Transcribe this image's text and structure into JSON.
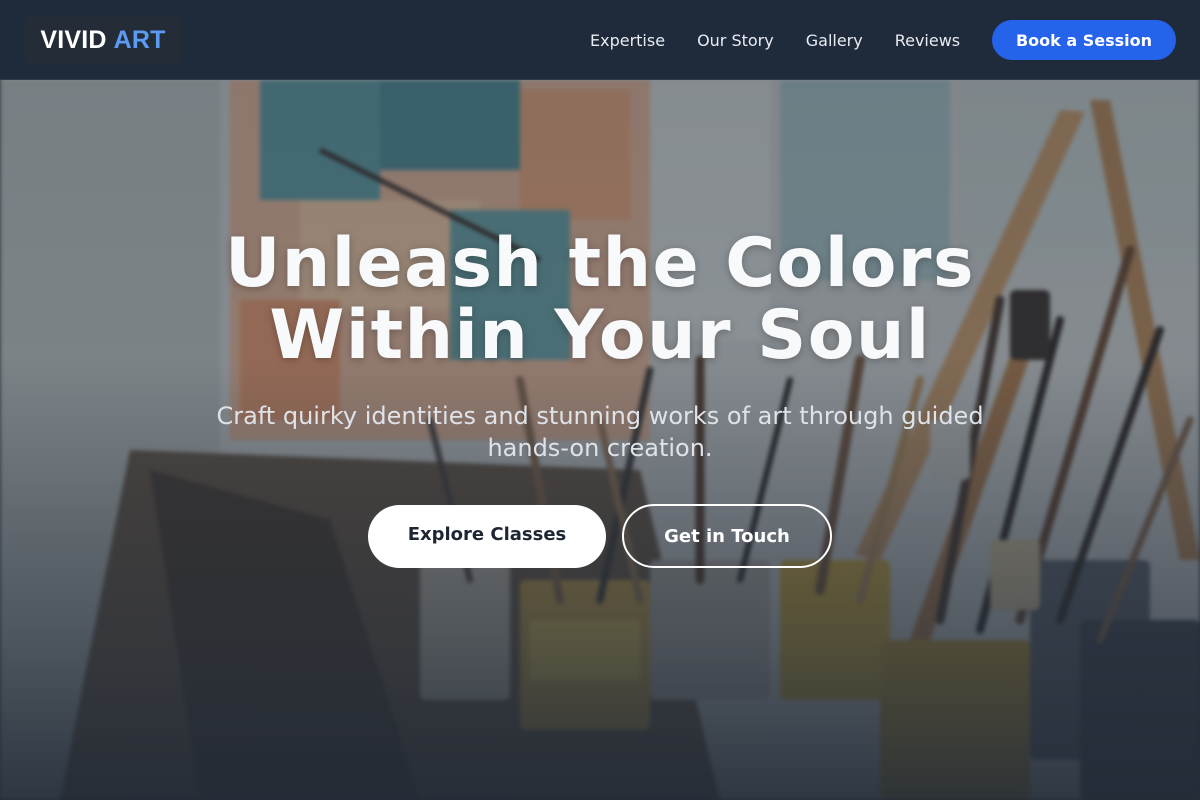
{
  "brand": {
    "part1": "VIVID",
    "part2": "ART",
    "accent_color": "#5b9cf2"
  },
  "nav": {
    "links": [
      {
        "label": "Expertise"
      },
      {
        "label": "Our Story"
      },
      {
        "label": "Gallery"
      },
      {
        "label": "Reviews"
      }
    ],
    "cta_label": "Book a Session",
    "cta_color": "#2563eb"
  },
  "hero": {
    "title_line1": "Unleash the Colors",
    "title_line2": "Within Your Soul",
    "subtitle": "Craft quirky identities and stunning works of art through guided hands-on creation.",
    "primary_button": "Explore Classes",
    "secondary_button": "Get in Touch",
    "background_image": "painter-studio-brushes-and-paint-cans"
  }
}
